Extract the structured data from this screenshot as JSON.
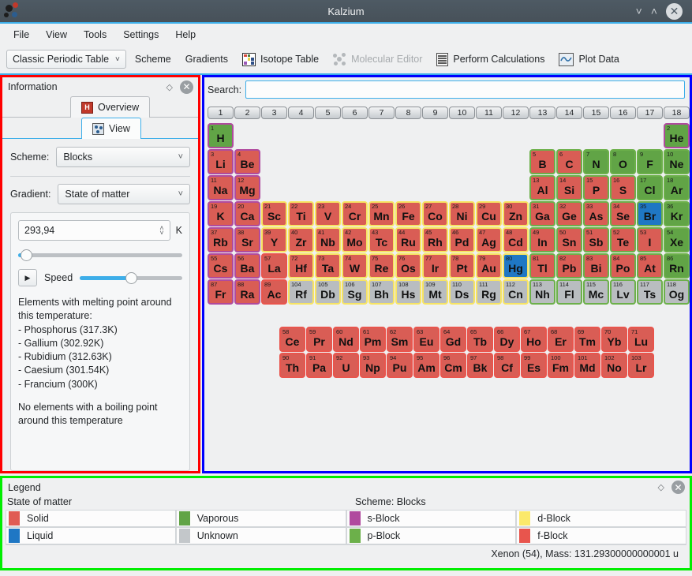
{
  "window": {
    "title": "Kalzium",
    "minimize_icon": "chevron-down-icon",
    "maximize_icon": "chevron-up-icon",
    "close_icon": "close-icon",
    "close_glyph": "✕"
  },
  "menubar": [
    "File",
    "View",
    "Tools",
    "Settings",
    "Help"
  ],
  "toolbar": {
    "table_selector": "Classic Periodic Table",
    "scheme": "Scheme",
    "gradients": "Gradients",
    "isotope_table": "Isotope Table",
    "molecular_editor": "Molecular Editor",
    "perform_calculations": "Perform Calculations",
    "plot_data": "Plot Data"
  },
  "info_panel": {
    "title": "Information",
    "tabs": [
      {
        "label": "Overview",
        "icon": "element-h-icon",
        "active": false
      },
      {
        "label": "View",
        "icon": "view-icon",
        "active": true
      }
    ],
    "scheme_label": "Scheme:",
    "scheme_value": "Blocks",
    "gradient_label": "Gradient:",
    "gradient_value": "State of matter",
    "temperature_value": "293,94",
    "temperature_unit": "K",
    "temperature_slider_pct": 5,
    "speed_label": "Speed",
    "speed_slider_pct": 50,
    "melting_heading": "Elements with melting point around this temperature:",
    "melting_list": [
      "- Phosphorus (317.3K)",
      "- Gallium (302.92K)",
      "- Rubidium (312.63K)",
      "- Caesium (301.54K)",
      "- Francium (300K)"
    ],
    "boiling_note": "No elements with a boiling point around this temperature"
  },
  "search": {
    "label": "Search:",
    "value": "",
    "placeholder": ""
  },
  "periodic_table": {
    "column_headers": [
      "1",
      "2",
      "3",
      "4",
      "5",
      "6",
      "7",
      "8",
      "9",
      "10",
      "11",
      "12",
      "13",
      "14",
      "15",
      "16",
      "17",
      "18"
    ],
    "state_colors": {
      "solid": "#d95d55",
      "liquid": "#1f77c4",
      "vaporous": "#61a446",
      "unknown": "#b9bdc0"
    },
    "block_colors": {
      "s": "#b04a9e",
      "p": "#6cb04a",
      "d": "#f7e463",
      "f": "#e8554d"
    },
    "rows": [
      [
        {
          "n": "1",
          "s": "H",
          "st": "vaporous",
          "b": "s"
        },
        null,
        null,
        null,
        null,
        null,
        null,
        null,
        null,
        null,
        null,
        null,
        null,
        null,
        null,
        null,
        null,
        {
          "n": "2",
          "s": "He",
          "st": "vaporous",
          "b": "s"
        }
      ],
      [
        {
          "n": "3",
          "s": "Li",
          "st": "solid",
          "b": "s"
        },
        {
          "n": "4",
          "s": "Be",
          "st": "solid",
          "b": "s"
        },
        null,
        null,
        null,
        null,
        null,
        null,
        null,
        null,
        null,
        null,
        {
          "n": "5",
          "s": "B",
          "st": "solid",
          "b": "p"
        },
        {
          "n": "6",
          "s": "C",
          "st": "solid",
          "b": "p"
        },
        {
          "n": "7",
          "s": "N",
          "st": "vaporous",
          "b": "p"
        },
        {
          "n": "8",
          "s": "O",
          "st": "vaporous",
          "b": "p"
        },
        {
          "n": "9",
          "s": "F",
          "st": "vaporous",
          "b": "p"
        },
        {
          "n": "10",
          "s": "Ne",
          "st": "vaporous",
          "b": "p"
        }
      ],
      [
        {
          "n": "11",
          "s": "Na",
          "st": "solid",
          "b": "s"
        },
        {
          "n": "12",
          "s": "Mg",
          "st": "solid",
          "b": "s"
        },
        null,
        null,
        null,
        null,
        null,
        null,
        null,
        null,
        null,
        null,
        {
          "n": "13",
          "s": "Al",
          "st": "solid",
          "b": "p"
        },
        {
          "n": "14",
          "s": "Si",
          "st": "solid",
          "b": "p"
        },
        {
          "n": "15",
          "s": "P",
          "st": "solid",
          "b": "p"
        },
        {
          "n": "16",
          "s": "S",
          "st": "solid",
          "b": "p"
        },
        {
          "n": "17",
          "s": "Cl",
          "st": "vaporous",
          "b": "p"
        },
        {
          "n": "18",
          "s": "Ar",
          "st": "vaporous",
          "b": "p"
        }
      ],
      [
        {
          "n": "19",
          "s": "K",
          "st": "solid",
          "b": "s"
        },
        {
          "n": "20",
          "s": "Ca",
          "st": "solid",
          "b": "s"
        },
        {
          "n": "21",
          "s": "Sc",
          "st": "solid",
          "b": "d"
        },
        {
          "n": "22",
          "s": "Ti",
          "st": "solid",
          "b": "d"
        },
        {
          "n": "23",
          "s": "V",
          "st": "solid",
          "b": "d"
        },
        {
          "n": "24",
          "s": "Cr",
          "st": "solid",
          "b": "d"
        },
        {
          "n": "25",
          "s": "Mn",
          "st": "solid",
          "b": "d"
        },
        {
          "n": "26",
          "s": "Fe",
          "st": "solid",
          "b": "d"
        },
        {
          "n": "27",
          "s": "Co",
          "st": "solid",
          "b": "d"
        },
        {
          "n": "28",
          "s": "Ni",
          "st": "solid",
          "b": "d"
        },
        {
          "n": "29",
          "s": "Cu",
          "st": "solid",
          "b": "d"
        },
        {
          "n": "30",
          "s": "Zn",
          "st": "solid",
          "b": "d"
        },
        {
          "n": "31",
          "s": "Ga",
          "st": "solid",
          "b": "p"
        },
        {
          "n": "32",
          "s": "Ge",
          "st": "solid",
          "b": "p"
        },
        {
          "n": "33",
          "s": "As",
          "st": "solid",
          "b": "p"
        },
        {
          "n": "34",
          "s": "Se",
          "st": "solid",
          "b": "p"
        },
        {
          "n": "35",
          "s": "Br",
          "st": "liquid",
          "b": "p"
        },
        {
          "n": "36",
          "s": "Kr",
          "st": "vaporous",
          "b": "p"
        }
      ],
      [
        {
          "n": "37",
          "s": "Rb",
          "st": "solid",
          "b": "s"
        },
        {
          "n": "38",
          "s": "Sr",
          "st": "solid",
          "b": "s"
        },
        {
          "n": "39",
          "s": "Y",
          "st": "solid",
          "b": "d"
        },
        {
          "n": "40",
          "s": "Zr",
          "st": "solid",
          "b": "d"
        },
        {
          "n": "41",
          "s": "Nb",
          "st": "solid",
          "b": "d"
        },
        {
          "n": "42",
          "s": "Mo",
          "st": "solid",
          "b": "d"
        },
        {
          "n": "43",
          "s": "Tc",
          "st": "solid",
          "b": "d"
        },
        {
          "n": "44",
          "s": "Ru",
          "st": "solid",
          "b": "d"
        },
        {
          "n": "45",
          "s": "Rh",
          "st": "solid",
          "b": "d"
        },
        {
          "n": "46",
          "s": "Pd",
          "st": "solid",
          "b": "d"
        },
        {
          "n": "47",
          "s": "Ag",
          "st": "solid",
          "b": "d"
        },
        {
          "n": "48",
          "s": "Cd",
          "st": "solid",
          "b": "d"
        },
        {
          "n": "49",
          "s": "In",
          "st": "solid",
          "b": "p"
        },
        {
          "n": "50",
          "s": "Sn",
          "st": "solid",
          "b": "p"
        },
        {
          "n": "51",
          "s": "Sb",
          "st": "solid",
          "b": "p"
        },
        {
          "n": "52",
          "s": "Te",
          "st": "solid",
          "b": "p"
        },
        {
          "n": "53",
          "s": "I",
          "st": "solid",
          "b": "p"
        },
        {
          "n": "54",
          "s": "Xe",
          "st": "vaporous",
          "b": "p"
        }
      ],
      [
        {
          "n": "55",
          "s": "Cs",
          "st": "solid",
          "b": "s"
        },
        {
          "n": "56",
          "s": "Ba",
          "st": "solid",
          "b": "s"
        },
        {
          "n": "57",
          "s": "La",
          "st": "solid",
          "b": "f"
        },
        {
          "n": "72",
          "s": "Hf",
          "st": "solid",
          "b": "d"
        },
        {
          "n": "73",
          "s": "Ta",
          "st": "solid",
          "b": "d"
        },
        {
          "n": "74",
          "s": "W",
          "st": "solid",
          "b": "d"
        },
        {
          "n": "75",
          "s": "Re",
          "st": "solid",
          "b": "d"
        },
        {
          "n": "76",
          "s": "Os",
          "st": "solid",
          "b": "d"
        },
        {
          "n": "77",
          "s": "Ir",
          "st": "solid",
          "b": "d"
        },
        {
          "n": "78",
          "s": "Pt",
          "st": "solid",
          "b": "d"
        },
        {
          "n": "79",
          "s": "Au",
          "st": "solid",
          "b": "d"
        },
        {
          "n": "80",
          "s": "Hg",
          "st": "liquid",
          "b": "d"
        },
        {
          "n": "81",
          "s": "Tl",
          "st": "solid",
          "b": "p"
        },
        {
          "n": "82",
          "s": "Pb",
          "st": "solid",
          "b": "p"
        },
        {
          "n": "83",
          "s": "Bi",
          "st": "solid",
          "b": "p"
        },
        {
          "n": "84",
          "s": "Po",
          "st": "solid",
          "b": "p"
        },
        {
          "n": "85",
          "s": "At",
          "st": "solid",
          "b": "p"
        },
        {
          "n": "86",
          "s": "Rn",
          "st": "vaporous",
          "b": "p"
        }
      ],
      [
        {
          "n": "87",
          "s": "Fr",
          "st": "solid",
          "b": "s"
        },
        {
          "n": "88",
          "s": "Ra",
          "st": "solid",
          "b": "s"
        },
        {
          "n": "89",
          "s": "Ac",
          "st": "solid",
          "b": "f"
        },
        {
          "n": "104",
          "s": "Rf",
          "st": "unknown",
          "b": "d"
        },
        {
          "n": "105",
          "s": "Db",
          "st": "unknown",
          "b": "d"
        },
        {
          "n": "106",
          "s": "Sg",
          "st": "unknown",
          "b": "d"
        },
        {
          "n": "107",
          "s": "Bh",
          "st": "unknown",
          "b": "d"
        },
        {
          "n": "108",
          "s": "Hs",
          "st": "unknown",
          "b": "d"
        },
        {
          "n": "109",
          "s": "Mt",
          "st": "unknown",
          "b": "d"
        },
        {
          "n": "110",
          "s": "Ds",
          "st": "unknown",
          "b": "d"
        },
        {
          "n": "111",
          "s": "Rg",
          "st": "unknown",
          "b": "d"
        },
        {
          "n": "112",
          "s": "Cn",
          "st": "unknown",
          "b": "d"
        },
        {
          "n": "113",
          "s": "Nh",
          "st": "unknown",
          "b": "p"
        },
        {
          "n": "114",
          "s": "Fl",
          "st": "unknown",
          "b": "p"
        },
        {
          "n": "115",
          "s": "Mc",
          "st": "unknown",
          "b": "p"
        },
        {
          "n": "116",
          "s": "Lv",
          "st": "unknown",
          "b": "p"
        },
        {
          "n": "117",
          "s": "Ts",
          "st": "unknown",
          "b": "p"
        },
        {
          "n": "118",
          "s": "Og",
          "st": "unknown",
          "b": "p"
        }
      ]
    ],
    "lanthanides": [
      {
        "n": "58",
        "s": "Ce",
        "st": "solid",
        "b": "f"
      },
      {
        "n": "59",
        "s": "Pr",
        "st": "solid",
        "b": "f"
      },
      {
        "n": "60",
        "s": "Nd",
        "st": "solid",
        "b": "f"
      },
      {
        "n": "61",
        "s": "Pm",
        "st": "solid",
        "b": "f"
      },
      {
        "n": "62",
        "s": "Sm",
        "st": "solid",
        "b": "f"
      },
      {
        "n": "63",
        "s": "Eu",
        "st": "solid",
        "b": "f"
      },
      {
        "n": "64",
        "s": "Gd",
        "st": "solid",
        "b": "f"
      },
      {
        "n": "65",
        "s": "Tb",
        "st": "solid",
        "b": "f"
      },
      {
        "n": "66",
        "s": "Dy",
        "st": "solid",
        "b": "f"
      },
      {
        "n": "67",
        "s": "Ho",
        "st": "solid",
        "b": "f"
      },
      {
        "n": "68",
        "s": "Er",
        "st": "solid",
        "b": "f"
      },
      {
        "n": "69",
        "s": "Tm",
        "st": "solid",
        "b": "f"
      },
      {
        "n": "70",
        "s": "Yb",
        "st": "solid",
        "b": "f"
      },
      {
        "n": "71",
        "s": "Lu",
        "st": "solid",
        "b": "f"
      }
    ],
    "actinides": [
      {
        "n": "90",
        "s": "Th",
        "st": "solid",
        "b": "f"
      },
      {
        "n": "91",
        "s": "Pa",
        "st": "solid",
        "b": "f"
      },
      {
        "n": "92",
        "s": "U",
        "st": "solid",
        "b": "f"
      },
      {
        "n": "93",
        "s": "Np",
        "st": "solid",
        "b": "f"
      },
      {
        "n": "94",
        "s": "Pu",
        "st": "solid",
        "b": "f"
      },
      {
        "n": "95",
        "s": "Am",
        "st": "solid",
        "b": "f"
      },
      {
        "n": "96",
        "s": "Cm",
        "st": "solid",
        "b": "f"
      },
      {
        "n": "97",
        "s": "Bk",
        "st": "solid",
        "b": "f"
      },
      {
        "n": "98",
        "s": "Cf",
        "st": "solid",
        "b": "f"
      },
      {
        "n": "99",
        "s": "Es",
        "st": "solid",
        "b": "f"
      },
      {
        "n": "100",
        "s": "Fm",
        "st": "solid",
        "b": "f"
      },
      {
        "n": "101",
        "s": "Md",
        "st": "solid",
        "b": "f"
      },
      {
        "n": "102",
        "s": "No",
        "st": "solid",
        "b": "f"
      },
      {
        "n": "103",
        "s": "Lr",
        "st": "solid",
        "b": "f"
      }
    ]
  },
  "legend": {
    "title": "Legend",
    "group1_title": "State of matter",
    "group2_title": "Scheme: Blocks",
    "items": [
      {
        "label": "Solid",
        "color": "#e05c54"
      },
      {
        "label": "Vaporous",
        "color": "#61a446"
      },
      {
        "label": "s-Block",
        "color": "#b04a9e"
      },
      {
        "label": "d-Block",
        "color": "#fbe96b"
      },
      {
        "label": "Liquid",
        "color": "#1f77c4"
      },
      {
        "label": "Unknown",
        "color": "#c3c7ca"
      },
      {
        "label": "p-Block",
        "color": "#6cb04a"
      },
      {
        "label": "f-Block",
        "color": "#e8554d"
      }
    ]
  },
  "statusbar": {
    "text": "Xenon (54), Mass: 131.29300000000001 u"
  }
}
